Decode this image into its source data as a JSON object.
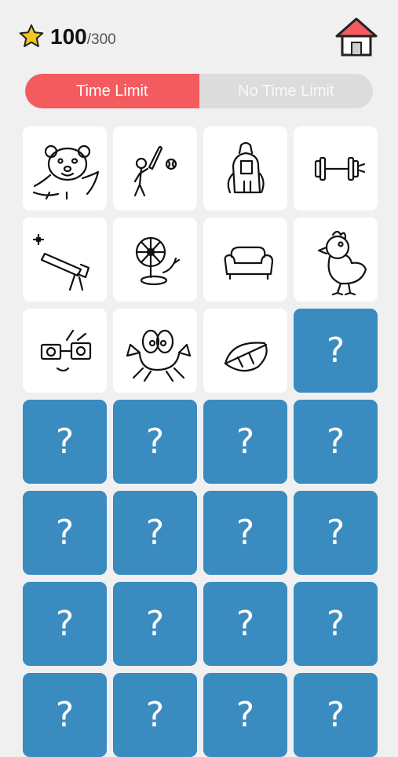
{
  "score": {
    "value": "100",
    "total": "/300"
  },
  "mode_toggle": {
    "active": "Time Limit",
    "inactive": "No Time Limit"
  },
  "hidden_symbol": "?",
  "colors": {
    "accent_red": "#f45b5e",
    "card_blue": "#3a8bbf",
    "background": "#f0f0f0"
  },
  "cards": [
    {
      "state": "revealed",
      "icon": "bear-drawing-icon"
    },
    {
      "state": "revealed",
      "icon": "baseball-player-drawing-icon"
    },
    {
      "state": "revealed",
      "icon": "backpack-drawing-icon"
    },
    {
      "state": "revealed",
      "icon": "dumbbell-drawing-icon"
    },
    {
      "state": "revealed",
      "icon": "telescope-drawing-icon"
    },
    {
      "state": "revealed",
      "icon": "fan-drawing-icon"
    },
    {
      "state": "revealed",
      "icon": "sofa-drawing-icon"
    },
    {
      "state": "revealed",
      "icon": "bird-drawing-icon"
    },
    {
      "state": "revealed",
      "icon": "glasses-drawing-icon"
    },
    {
      "state": "revealed",
      "icon": "crab-drawing-icon"
    },
    {
      "state": "revealed",
      "icon": "leaf-drawing-icon"
    },
    {
      "state": "hidden"
    },
    {
      "state": "hidden"
    },
    {
      "state": "hidden"
    },
    {
      "state": "hidden"
    },
    {
      "state": "hidden"
    },
    {
      "state": "hidden"
    },
    {
      "state": "hidden"
    },
    {
      "state": "hidden"
    },
    {
      "state": "hidden"
    },
    {
      "state": "hidden"
    },
    {
      "state": "hidden"
    },
    {
      "state": "hidden"
    },
    {
      "state": "hidden"
    },
    {
      "state": "hidden"
    },
    {
      "state": "hidden"
    },
    {
      "state": "hidden"
    },
    {
      "state": "hidden"
    }
  ]
}
